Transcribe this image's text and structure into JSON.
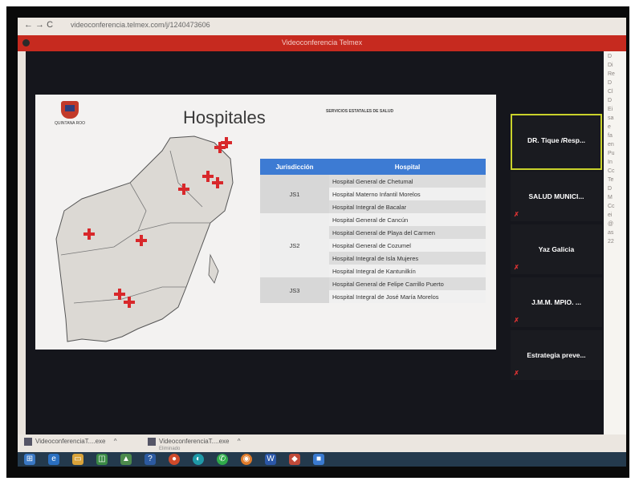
{
  "browser": {
    "url": "videoconferencia.telmex.com/j/1240473606",
    "window_title": "Videoconferencia Telmex"
  },
  "slide": {
    "title": "Hospitales",
    "header_right": "SERVICIOS ESTATALES DE SALUD",
    "logo_caption": "QUINTANA ROO",
    "table": {
      "headers": [
        "Jurisdicción",
        "Hospital"
      ],
      "groups": [
        {
          "jurisdiccion": "JS1",
          "hospitals": [
            "Hospital General de Chetumal",
            "Hospital Materno Infantil Morelos",
            "Hospital Integral de Bacalar"
          ]
        },
        {
          "jurisdiccion": "JS2",
          "hospitals": [
            "Hospital General de Cancún",
            "Hospital General de Playa del Carmen",
            "Hospital General de Cozumel",
            "Hospital Integral de Isla Mujeres",
            "Hospital Integral de Kantunilkín"
          ]
        },
        {
          "jurisdiccion": "JS3",
          "hospitals": [
            "Hospital General de Felipe Carrillo Puerto",
            "Hospital Integral de José María Morelos"
          ]
        }
      ]
    }
  },
  "participants": [
    {
      "name": "DR. Tique /Resp...",
      "active": true
    },
    {
      "name": "SALUD MUNICI...",
      "active": false
    },
    {
      "name": "Yaz Galicia",
      "active": false
    },
    {
      "name": "J.M.M. MPIO. ...",
      "active": false
    },
    {
      "name": "Estrategia preve...",
      "active": false
    }
  ],
  "downloads": [
    {
      "name": "VideoconferenciaT....exe"
    },
    {
      "name": "VideoconferenciaT....exe",
      "status": "Eliminado"
    }
  ],
  "taskbar_icons": [
    "windows-icon",
    "edge-icon",
    "file-explorer-icon",
    "store-icon",
    "photos-icon",
    "help-icon",
    "chrome-icon",
    "edge-chromium-icon",
    "whatsapp-icon",
    "firefox-icon",
    "word-icon",
    "media-icon",
    "camera-icon"
  ]
}
